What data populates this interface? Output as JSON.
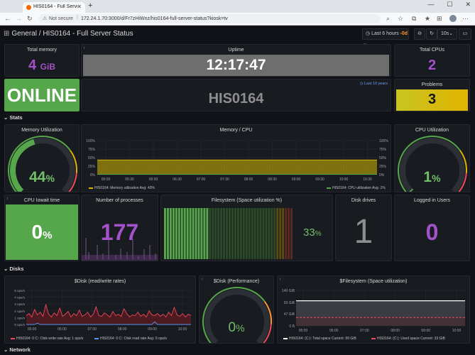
{
  "browser": {
    "tab_title": "HIS0164 - Full Server Status - Gr...",
    "new_tab": "+",
    "not_secure": "Not secure",
    "url": "172.24.1.70:3000/d/Fr7zHiWnz/his0164-full-server-status?kiosk=tv"
  },
  "header": {
    "breadcrumb_folder": "General",
    "breadcrumb_sep": "/",
    "breadcrumb_title": "HIS0164 - Full Server Status",
    "time_range": "Last 6 hours",
    "time_offset": "-0d",
    "refresh": "10s"
  },
  "panels": {
    "total_memory": {
      "title": "Total memory",
      "value": "4",
      "unit": "GiB"
    },
    "uptime": {
      "title": "Uptime",
      "value": "12:17:47"
    },
    "total_cpus": {
      "title": "Total CPUs",
      "value": "2"
    },
    "status": {
      "value": "ONLINE"
    },
    "hostname": {
      "value": "HIS0164",
      "time_note": "Last 10 years"
    },
    "problems": {
      "title": "Problems",
      "value": "3"
    },
    "memory_util": {
      "title": "Memory Utilization",
      "value": "44",
      "unit": "%"
    },
    "cpu_util": {
      "title": "CPU Utilization",
      "value": "1",
      "unit": "%"
    },
    "cpu_iowait": {
      "title": "CPU Iowait time",
      "value": "0",
      "unit": "%"
    },
    "num_processes": {
      "title": "Number of processes",
      "value": "177"
    },
    "fs_util": {
      "title": "Filesystem (Space utilization %)",
      "value": "33",
      "unit": "%"
    },
    "disk_drives": {
      "title": "Disk drives",
      "value": "1"
    },
    "logged_users": {
      "title": "Logged in Users",
      "value": "0"
    },
    "disk_perf": {
      "title": "$Disk (Performance)",
      "value": "0",
      "unit": "%"
    }
  },
  "rows": {
    "stats": "Stats",
    "disks": "Disks",
    "network": "Network"
  },
  "colors": {
    "green": "#56a64b",
    "green_text": "#73bf69",
    "purple": "#a352cc",
    "yellow": "#e0b400",
    "orange": "#ff9830",
    "red": "#f2495c",
    "blue": "#5794f2",
    "grey_bar": "#6e6e6e"
  },
  "charts": {
    "memory_cpu": {
      "title": "Memory / CPU",
      "legend_left": "HIS0164: Memory utilization",
      "legend_left_avg": "Avg: 43%",
      "legend_right": "HIS0164: CPU utilization",
      "legend_right_avg": "Avg: 1%"
    },
    "disk_rw": {
      "title": "$Disk (read/write rates)",
      "legend_1": "HIS0164: 0 C:: Disk write rate",
      "legend_1_avg": "Avg: 1 ops/s",
      "legend_2": "HIS0164: 0 C:: Disk read rate",
      "legend_2_avg": "Avg: 0 ops/s"
    },
    "fs_space": {
      "title": "$Filesystem (Space utilization)",
      "legend_1": "HIS0164: (C:): Total space",
      "legend_1_cur": "Current: 99 GiB",
      "legend_2": "HIS0164: (C:): Used space",
      "legend_2_cur": "Current: 33 GiB"
    }
  },
  "chart_data": [
    {
      "type": "area",
      "title": "Memory / CPU",
      "x": [
        "05:00",
        "05:30",
        "06:00",
        "06:30",
        "07:00",
        "07:30",
        "08:00",
        "08:30",
        "09:00",
        "09:30",
        "10:00",
        "10:30"
      ],
      "y_ticks": [
        "0%",
        "25%",
        "50%",
        "75%",
        "100%"
      ],
      "ylim": [
        0,
        100
      ],
      "series": [
        {
          "name": "HIS0164: Memory utilization",
          "values": [
            43,
            43,
            43,
            43,
            43,
            43,
            43,
            43,
            43,
            43,
            43,
            43
          ]
        },
        {
          "name": "HIS0164: CPU utilization",
          "values": [
            1,
            1,
            1,
            1,
            1,
            1,
            1,
            1,
            1,
            1,
            1,
            1
          ]
        }
      ]
    },
    {
      "type": "line",
      "title": "$Disk (read/write rates)",
      "x": [
        "05:00",
        "06:00",
        "07:00",
        "08:00",
        "09:00",
        "10:00"
      ],
      "y_ticks": [
        "0 ops/s",
        "1 ops/s",
        "2 ops/s",
        "3 ops/s",
        "4 ops/s",
        "5 ops/s"
      ],
      "ylim": [
        0,
        5
      ],
      "series": [
        {
          "name": "HIS0164: 0 C:: Disk write rate",
          "values": [
            1.3,
            1.6,
            1.1,
            2.2,
            1.4,
            1.8,
            1.2,
            2.9,
            1.5,
            1.1,
            1.7,
            1.3,
            2.4,
            1.2,
            1.5,
            1.9,
            1.1,
            1.6,
            1.3,
            2.1,
            1.2,
            1.4,
            1.8,
            1.1,
            1.5,
            2.6,
            1.3,
            1.2,
            1.7,
            1.4,
            1.1,
            1.9,
            1.3,
            1.5,
            1.2,
            2.3,
            1.6,
            1.1,
            1.4,
            1.3,
            1.8,
            1.2,
            1.5,
            1.1,
            2.0,
            1.4,
            1.3,
            1.6,
            1.2,
            1.5,
            1.1,
            1.8,
            1.3,
            2.5,
            1.4,
            1.2,
            1.6,
            1.1,
            1.5,
            1.3
          ]
        },
        {
          "name": "HIS0164: 0 C:: Disk read rate",
          "values": [
            0,
            0,
            0,
            0,
            0.2,
            0,
            0,
            0,
            0,
            0,
            0,
            0,
            0,
            0,
            0,
            0,
            0,
            0,
            0,
            0,
            0,
            0,
            0,
            0,
            0,
            0,
            0,
            0,
            0,
            0,
            0,
            0,
            0,
            0,
            0,
            0,
            0,
            0,
            0,
            0,
            0,
            0,
            0,
            0,
            0,
            0,
            0.4,
            0,
            0,
            0,
            0,
            0,
            0,
            0,
            0,
            0,
            0,
            0,
            0,
            0
          ]
        }
      ]
    },
    {
      "type": "line",
      "title": "$Filesystem (Space utilization)",
      "x": [
        "05:00",
        "06:00",
        "07:00",
        "08:00",
        "09:00",
        "10:00"
      ],
      "y_ticks": [
        "0 B",
        "47 GiB",
        "93 GiB",
        "140 GiB"
      ],
      "ylim": [
        0,
        140
      ],
      "series": [
        {
          "name": "HIS0164: (C:): Total space",
          "values": [
            99,
            99,
            99,
            99,
            99,
            99
          ]
        },
        {
          "name": "HIS0164: (C:): Used space",
          "values": [
            33,
            33,
            33,
            33,
            33,
            33
          ]
        }
      ]
    }
  ]
}
